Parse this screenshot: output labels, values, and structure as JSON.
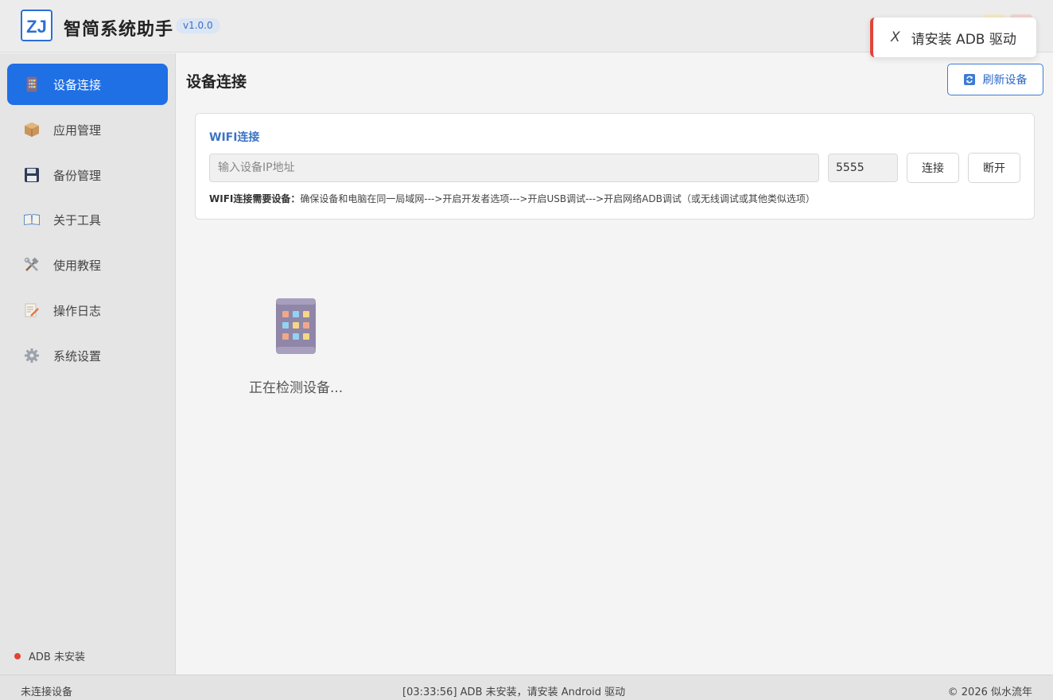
{
  "app": {
    "title": "智简系统助手",
    "version": "v1.0.0",
    "logo_text": "ZJ"
  },
  "toast": {
    "icon": "close-icon",
    "glyph": "X",
    "message": "请安装 ADB 驱动",
    "accent_color": "#e0453a"
  },
  "sidebar": {
    "items": [
      {
        "label": "设备连接",
        "icon": "phone-icon",
        "active": true
      },
      {
        "label": "应用管理",
        "icon": "package-icon",
        "active": false
      },
      {
        "label": "备份管理",
        "icon": "floppy-disk-icon",
        "active": false
      },
      {
        "label": "关于工具",
        "icon": "book-icon",
        "active": false
      },
      {
        "label": "使用教程",
        "icon": "tools-icon",
        "active": false
      },
      {
        "label": "操作日志",
        "icon": "memo-icon",
        "active": false
      },
      {
        "label": "系统设置",
        "icon": "gear-icon",
        "active": false
      }
    ],
    "adb_status": "ADB 未安装",
    "accent_color": "#1f6fe5"
  },
  "main": {
    "title": "设备连接",
    "refresh_label": "刷新设备",
    "wifi": {
      "title": "WIFI连接",
      "ip_placeholder": "输入设备IP地址",
      "port_value": "5555",
      "connect_label": "连接",
      "disconnect_label": "断开",
      "hint_label": "WIFI连接需要设备：",
      "hint_text": "确保设备和电脑在同一局域网--->开启开发者选项--->开启USB调试--->开启网络ADB调试（或无线调试或其他类似选项）"
    },
    "detecting_text": "正在检测设备..."
  },
  "statusbar": {
    "left": "未连接设备",
    "middle": "[03:33:56] ADB 未安装，请安装 Android 驱动",
    "right": "© 2026 似水流年"
  }
}
